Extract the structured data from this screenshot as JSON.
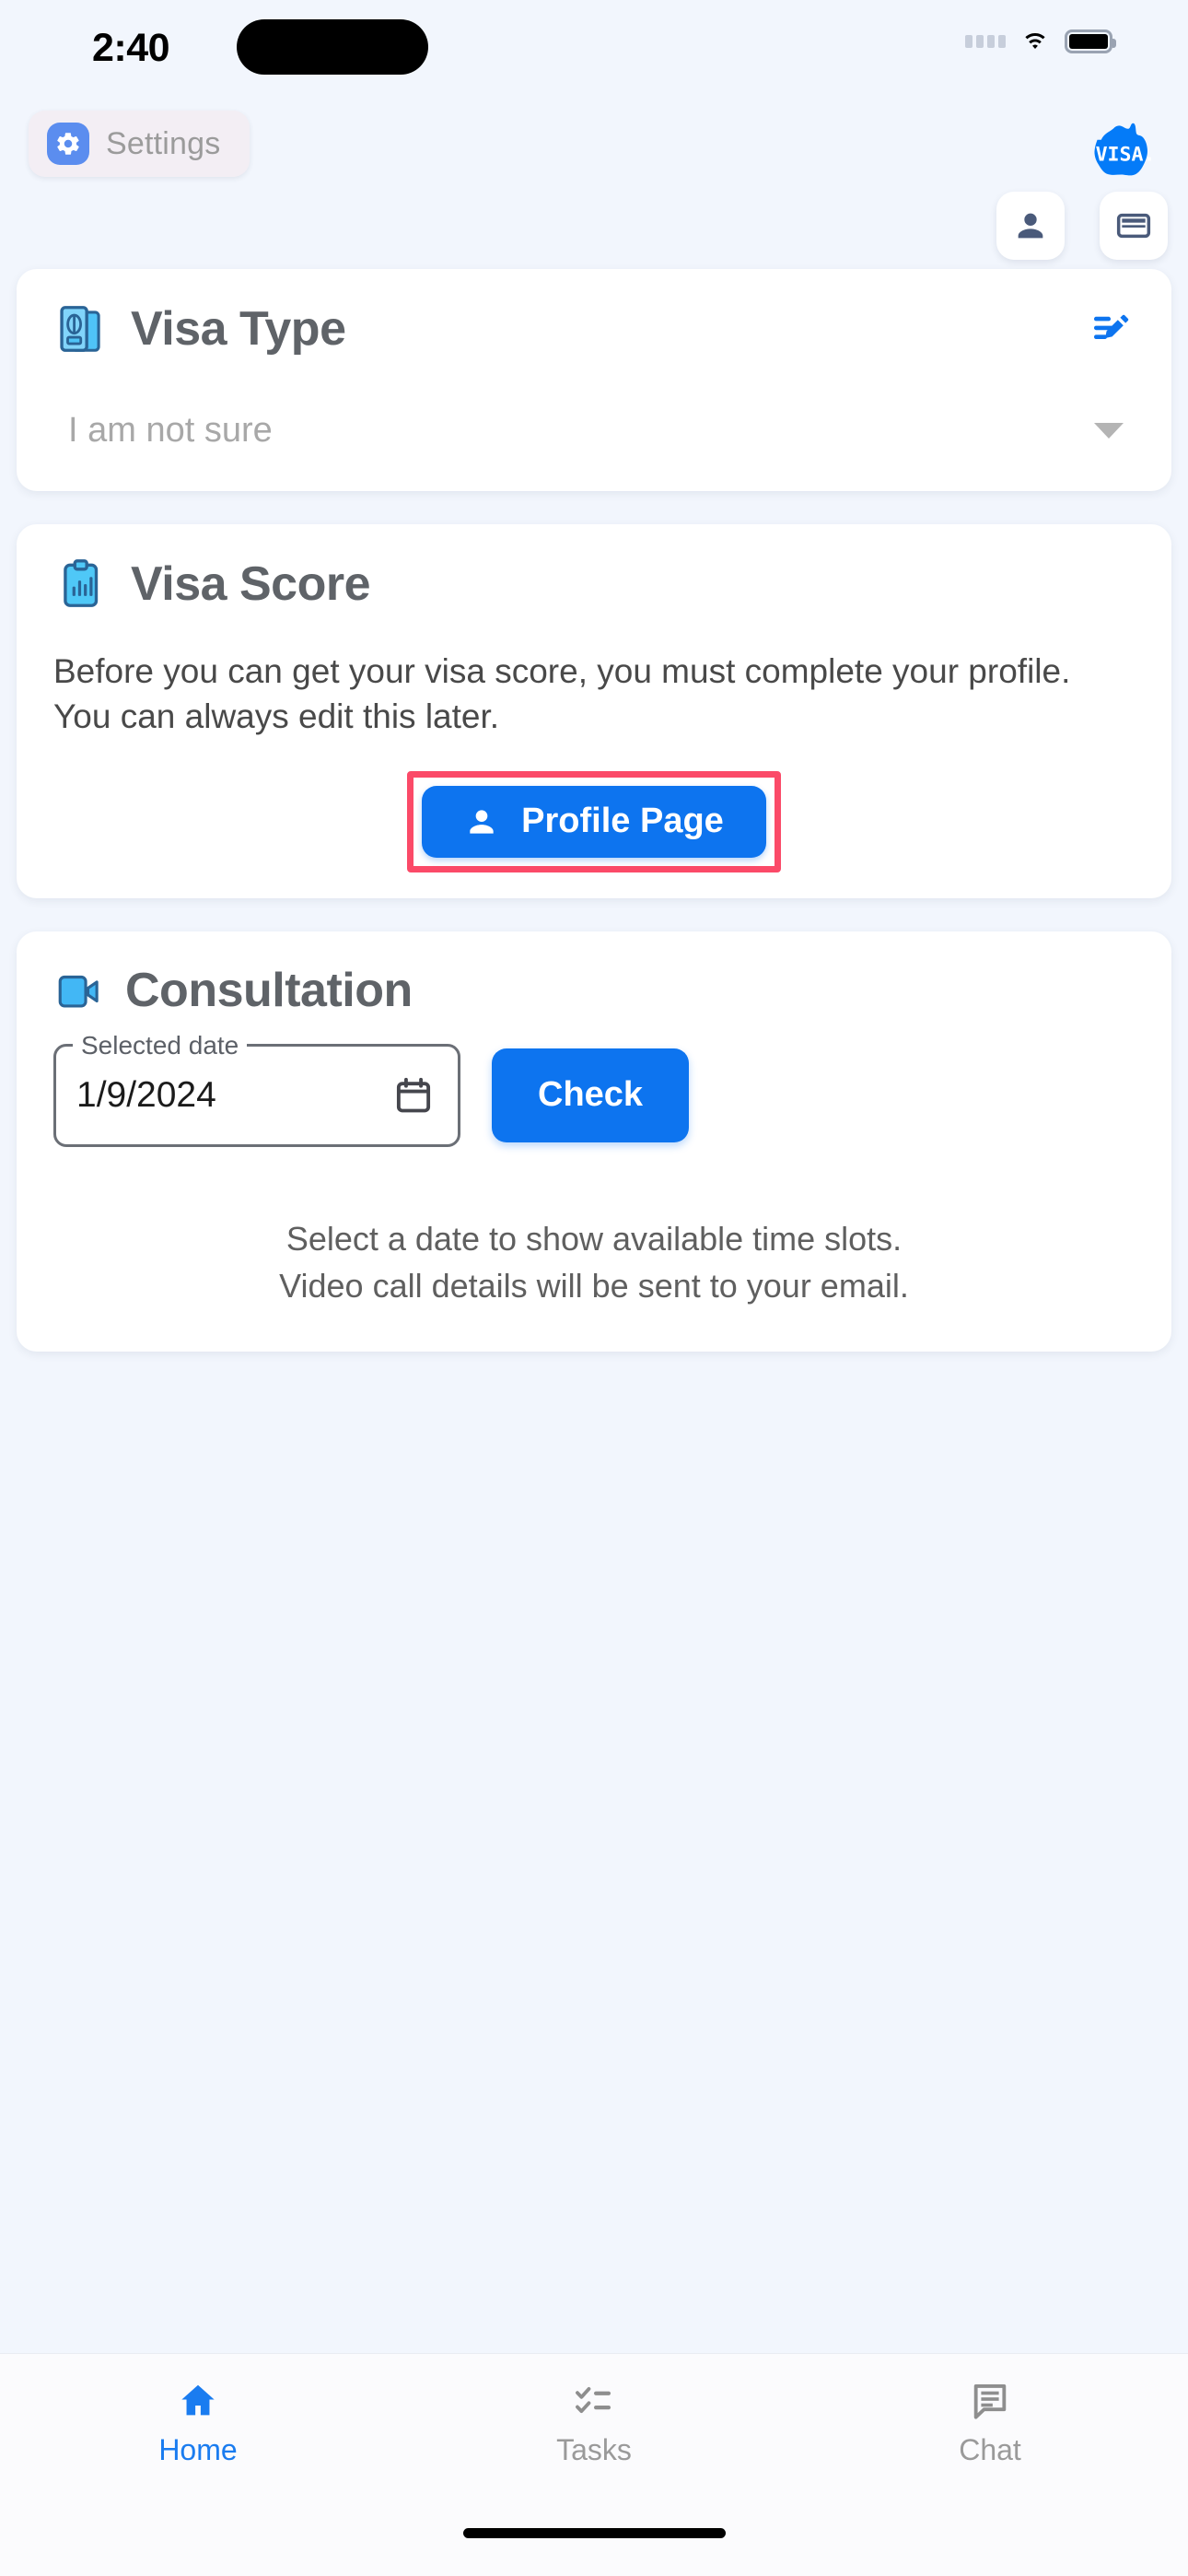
{
  "status_bar": {
    "time": "2:40",
    "signal_icon": "signal-dots-icon",
    "wifi_icon": "wifi-icon",
    "battery_icon": "battery-icon"
  },
  "header": {
    "settings_label": "Settings",
    "settings_icon": "gear-icon",
    "brand_name": "VISA.",
    "brand_icon": "australia-map-logo",
    "actions": [
      {
        "name": "profile-icon-button",
        "icon": "person-icon"
      },
      {
        "name": "payment-icon-button",
        "icon": "credit-card-icon"
      }
    ]
  },
  "visa_type_card": {
    "title": "Visa Type",
    "icon": "passport-icon",
    "edit_icon": "edit-list-icon",
    "selected_option": "I am not sure",
    "dropdown_icon": "caret-down-icon"
  },
  "visa_score_card": {
    "title": "Visa Score",
    "icon": "clipboard-chart-icon",
    "body": "Before you can get your visa score, you must complete your profile. You can always edit this later.",
    "button_label": "Profile Page",
    "button_icon": "person-icon",
    "button_highlighted": true
  },
  "consultation_card": {
    "title": "Consultation",
    "icon": "video-camera-icon",
    "date_label": "Selected date",
    "date_value": "1/9/2024",
    "calendar_icon": "calendar-icon",
    "check_label": "Check",
    "note_line_1": "Select a date to show available time slots.",
    "note_line_2": "Video call details will be sent to your email."
  },
  "bottom_nav": {
    "items": [
      {
        "label": "Home",
        "icon": "home-icon",
        "active": true
      },
      {
        "label": "Tasks",
        "icon": "checklist-icon",
        "active": false
      },
      {
        "label": "Chat",
        "icon": "message-icon",
        "active": false
      }
    ]
  },
  "colors": {
    "background": "#f2f6fd",
    "card": "#ffffff",
    "primary": "#0d74ef",
    "accent_highlight": "#fb4a68",
    "title_text": "#5f6368",
    "muted_text": "#9a9a9a",
    "icon_slate": "#4a5a7a"
  }
}
